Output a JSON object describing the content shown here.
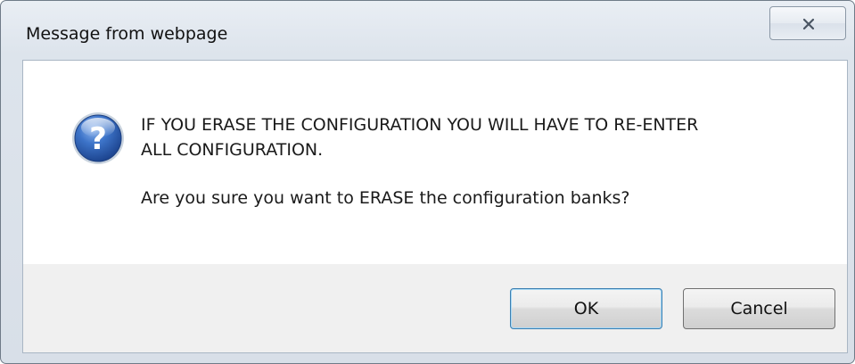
{
  "window": {
    "title": "Message from webpage",
    "close_icon": "close-x-icon"
  },
  "message": {
    "icon": "question-icon",
    "warning": "IF YOU ERASE THE CONFIGURATION YOU WILL HAVE TO RE-ENTER\nALL CONFIGURATION.",
    "question": "Are you sure you want to ERASE the configuration banks?"
  },
  "buttons": {
    "ok_label": "OK",
    "cancel_label": "Cancel"
  },
  "colors": {
    "accent": "#3c7fb1",
    "icon_blue": "#2f63b8"
  }
}
